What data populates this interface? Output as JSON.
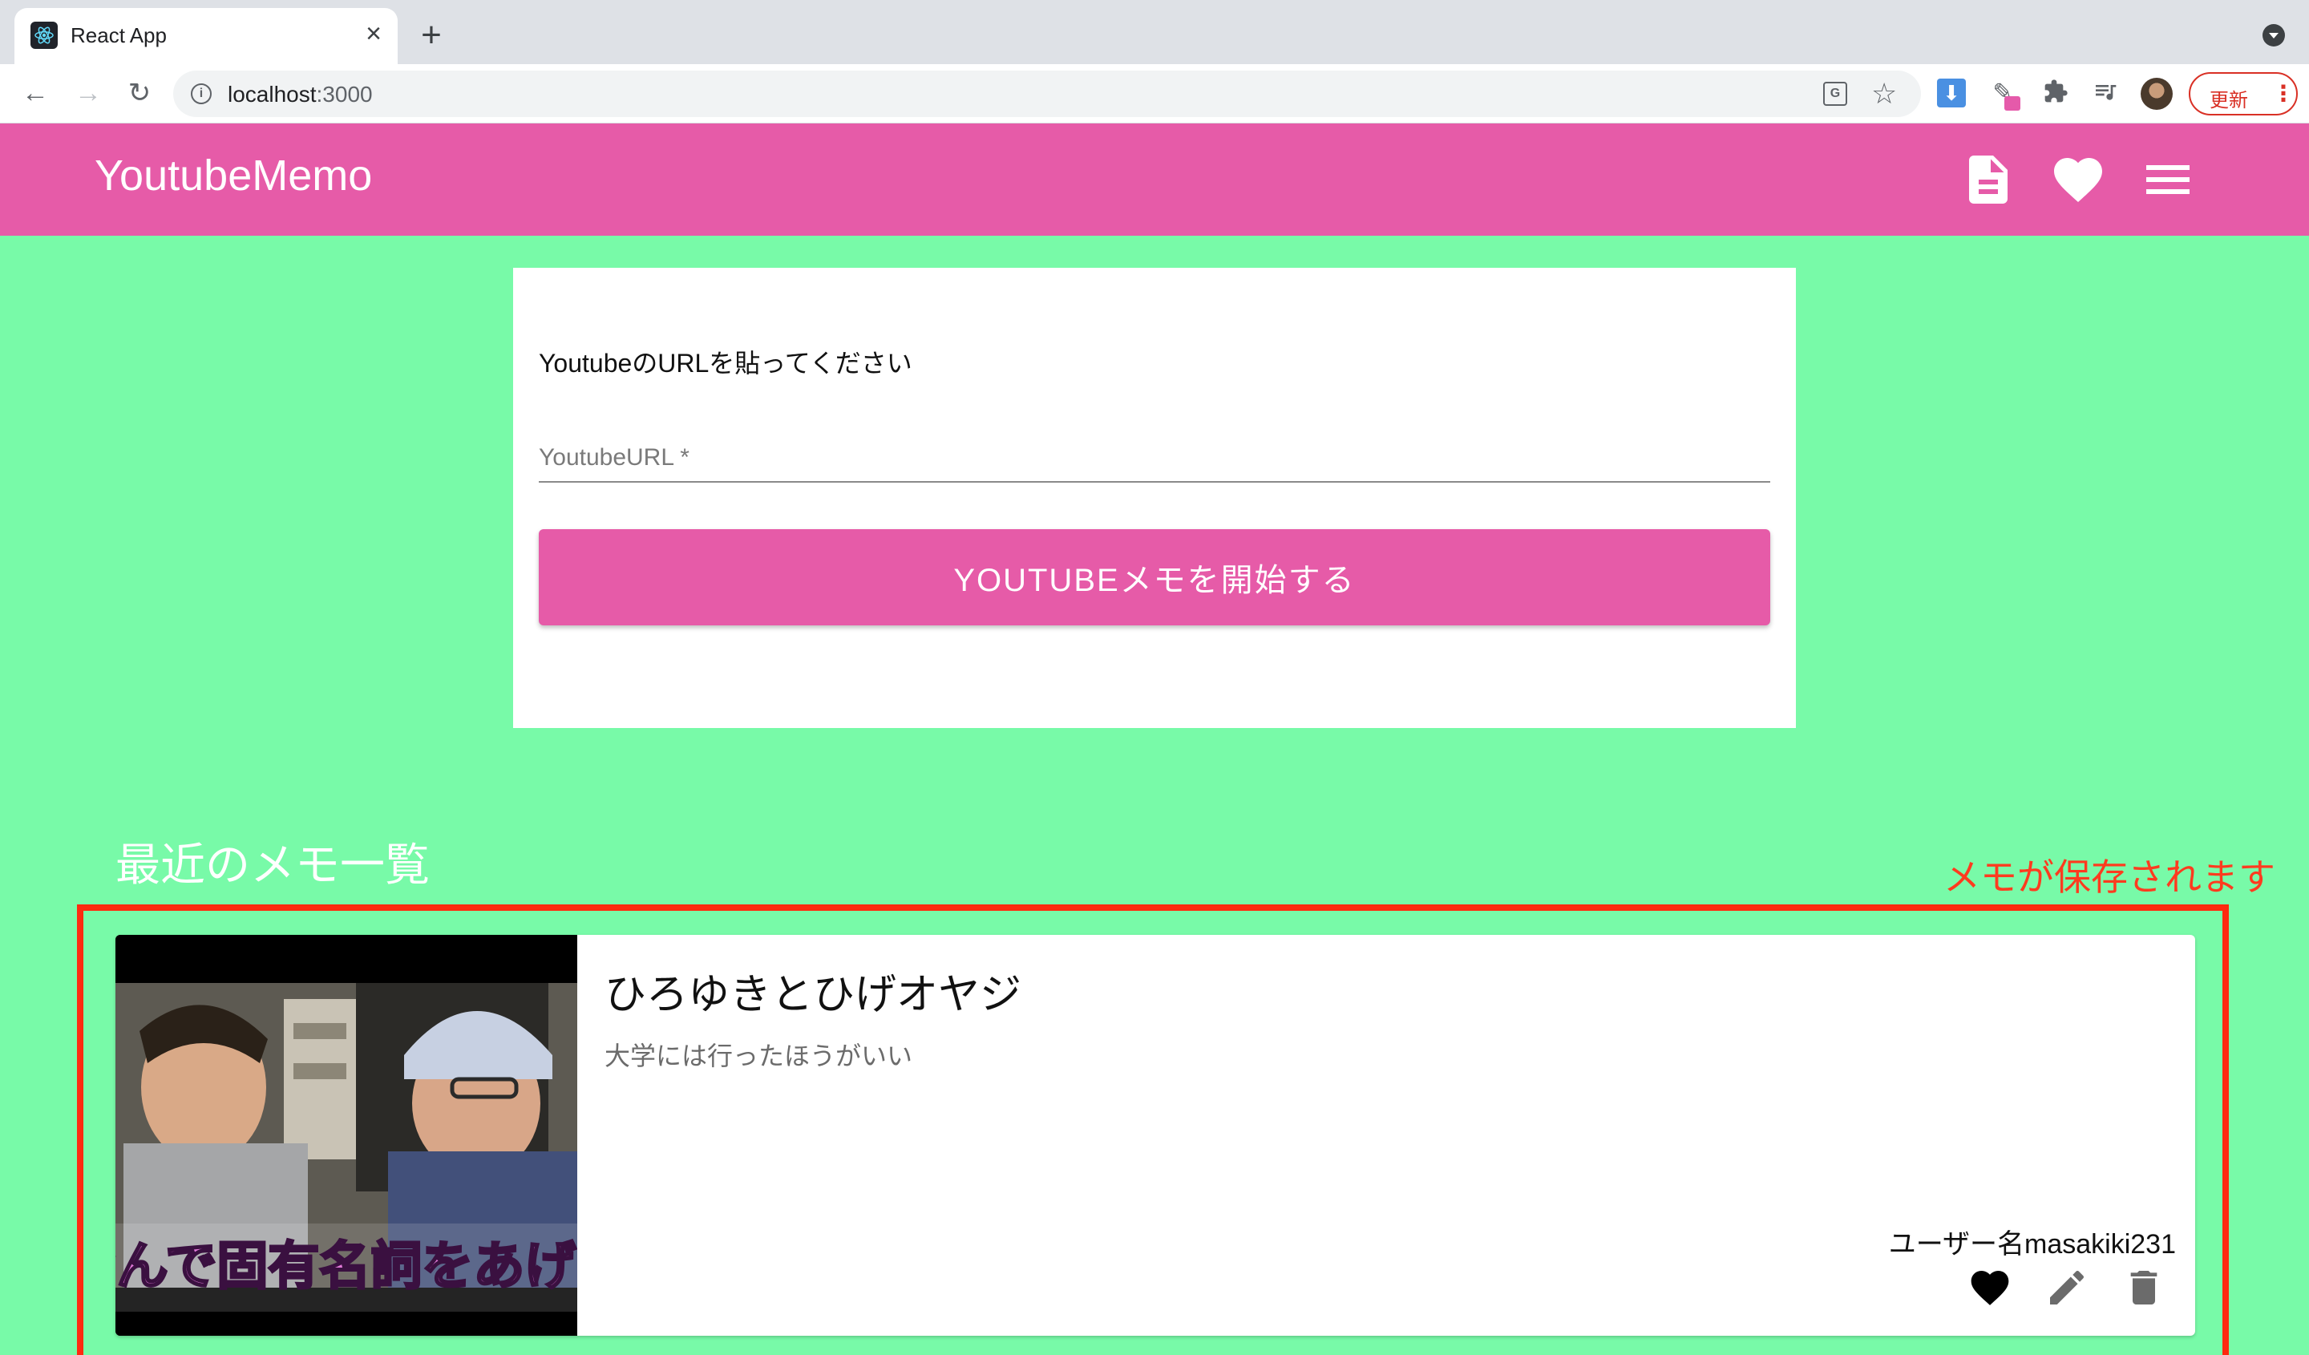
{
  "browser": {
    "tab_title": "React App",
    "tab_close": "×",
    "new_tab": "+",
    "url_host": "localhost",
    "url_port": ":3000",
    "update_label": "更新",
    "update_menu": "⋮",
    "nav_back": "←",
    "nav_forward": "→",
    "nav_reload": "↻",
    "star": "☆",
    "extension_icons": [
      "translate-icon",
      "download-extension-icon",
      "eyedropper-extension-icon",
      "puzzle-extensions-icon",
      "media-control-icon",
      "profile-avatar"
    ]
  },
  "appbar": {
    "title": "YoutubeMemo",
    "icons": [
      "document-icon",
      "heart-icon",
      "menu-icon"
    ],
    "color": "#e65ba8"
  },
  "form": {
    "prompt": "YoutubeのURLを貼ってください",
    "url_label": "YoutubeURL *",
    "url_value": "",
    "start_button": "YOUTUBEメモを開始する"
  },
  "recent": {
    "section_title": "最近のメモ一覧",
    "annotation": "メモが保存されます",
    "memos": [
      {
        "title": "ひろゆきとひげオヤジ",
        "subtitle": "大学には行ったほうがいい",
        "user": "ユーザー名masakiki231",
        "thumbnail_caption": "なんで固有名詞をあげた",
        "actions": [
          "heart-icon",
          "edit-icon",
          "delete-icon"
        ]
      }
    ]
  },
  "colors": {
    "page_background": "#78faa8",
    "accent_pink": "#e65ba8",
    "annotation_red": "#ff2a10"
  }
}
